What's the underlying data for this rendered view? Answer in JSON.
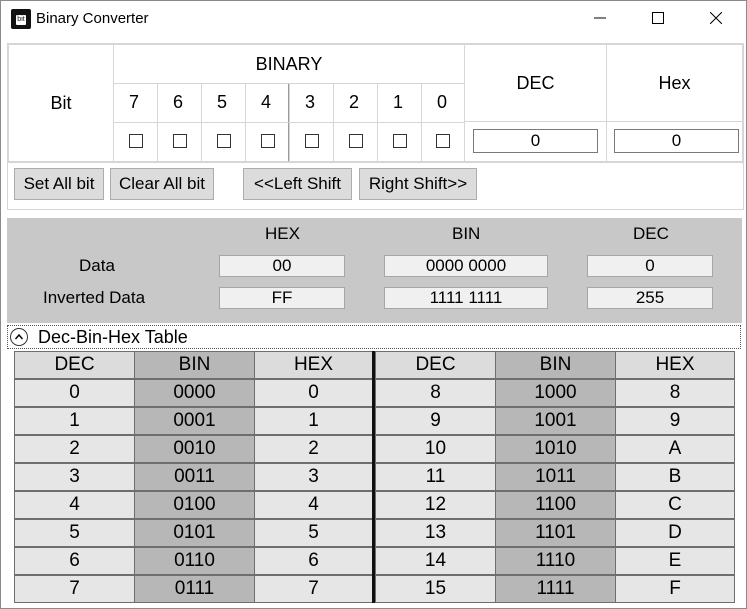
{
  "window": {
    "title": "Binary Converter",
    "icon_text": "bit"
  },
  "bits": {
    "header_bit": "Bit",
    "header_binary": "BINARY",
    "header_dec": "DEC",
    "header_hex": "Hex",
    "labels": [
      "7",
      "6",
      "5",
      "4",
      "3",
      "2",
      "1",
      "0"
    ],
    "dec_value": "0",
    "hex_value": "0"
  },
  "buttons": {
    "set_all": "Set All bit",
    "clear_all": "Clear All bit",
    "left_shift": "<<Left Shift",
    "right_shift": "Right Shift>>"
  },
  "data_section": {
    "col_hex": "HEX",
    "col_bin": "BIN",
    "col_dec": "DEC",
    "data_label": "Data",
    "inverted_label": "Inverted Data",
    "data_hex": "00",
    "data_bin": "0000 0000",
    "data_dec": "0",
    "inv_hex": "FF",
    "inv_bin": "1111 1111",
    "inv_dec": "255"
  },
  "table": {
    "expander_label": "Dec-Bin-Hex Table",
    "headers": [
      "DEC",
      "BIN",
      "HEX",
      "DEC",
      "BIN",
      "HEX"
    ],
    "rows": [
      [
        "0",
        "0000",
        "0",
        "8",
        "1000",
        "8"
      ],
      [
        "1",
        "0001",
        "1",
        "9",
        "1001",
        "9"
      ],
      [
        "2",
        "0010",
        "2",
        "10",
        "1010",
        "A"
      ],
      [
        "3",
        "0011",
        "3",
        "11",
        "1011",
        "B"
      ],
      [
        "4",
        "0100",
        "4",
        "12",
        "1100",
        "C"
      ],
      [
        "5",
        "0101",
        "5",
        "13",
        "1101",
        "D"
      ],
      [
        "6",
        "0110",
        "6",
        "14",
        "1110",
        "E"
      ],
      [
        "7",
        "0111",
        "7",
        "15",
        "1111",
        "F"
      ]
    ]
  }
}
